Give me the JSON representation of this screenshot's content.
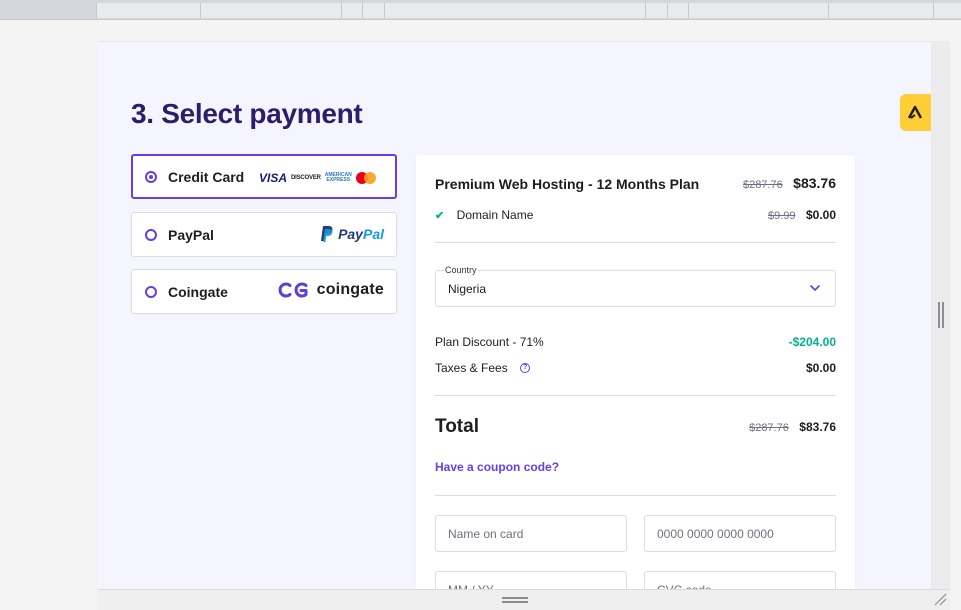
{
  "heading": "3. Select payment",
  "payment_methods": [
    {
      "name": "Credit Card",
      "selected": true
    },
    {
      "name": "PayPal",
      "selected": false
    },
    {
      "name": "Coingate",
      "selected": false
    }
  ],
  "card_logos": {
    "visa": "VISA",
    "discover": "DISCOVER",
    "amex_line1": "AMERICAN",
    "amex_line2": "EXPRESS"
  },
  "paypal_logo": {
    "part1": "Pay",
    "part2": "Pal"
  },
  "coingate_logo": "coingate",
  "summary": {
    "plan": {
      "name": "Premium Web Hosting - 12 Months Plan",
      "old_price": "$287.76",
      "price": "$83.76"
    },
    "domain": {
      "label": "Domain Name",
      "old_price": "$9.99",
      "price": "$0.00"
    },
    "country": {
      "label": "Country",
      "value": "Nigeria"
    },
    "discount": {
      "label": "Plan Discount - 71%",
      "value": "-$204.00"
    },
    "taxes": {
      "label": "Taxes & Fees",
      "help_icon": "?",
      "value": "$0.00"
    },
    "total": {
      "label": "Total",
      "old_price": "$287.76",
      "price": "$83.76"
    },
    "coupon_link": "Have a coupon code?"
  },
  "card_form": {
    "name_placeholder": "Name on card",
    "number_placeholder": "0000 0000 0000 0000",
    "expiry_placeholder": "MM / YY",
    "cvc_placeholder": "CVC code"
  },
  "colors": {
    "accent": "#673de6",
    "heading": "#2f1c6a",
    "success": "#00b090",
    "extension": "#ffcd35"
  },
  "icons": [
    "radio-icon",
    "check-icon",
    "chevron-down-icon",
    "help-icon",
    "extension-icon",
    "paypal-icon",
    "coingate-icon",
    "mastercard-icon"
  ]
}
